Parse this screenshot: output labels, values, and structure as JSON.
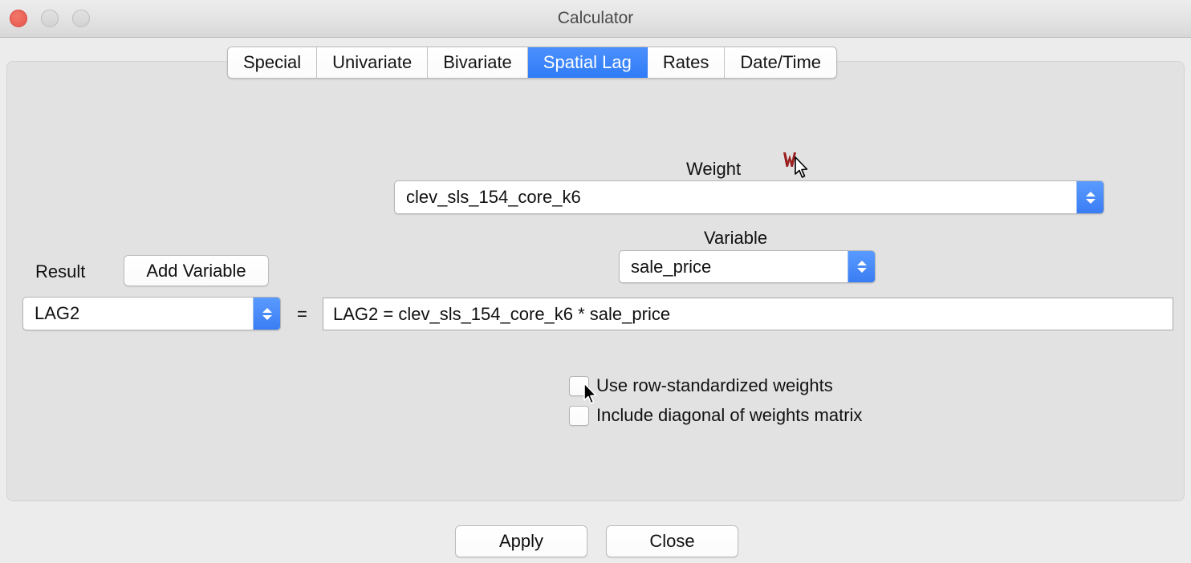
{
  "window": {
    "title": "Calculator",
    "traffic_lights": [
      {
        "name": "close",
        "color": "#e8564a"
      },
      {
        "name": "minimize",
        "color": "#d8d8d8"
      },
      {
        "name": "maximize",
        "color": "#d8d8d8"
      }
    ]
  },
  "tabs": [
    {
      "label": "Special",
      "active": false
    },
    {
      "label": "Univariate",
      "active": false
    },
    {
      "label": "Bivariate",
      "active": false
    },
    {
      "label": "Spatial Lag",
      "active": true
    },
    {
      "label": "Rates",
      "active": false
    },
    {
      "label": "Date/Time",
      "active": false
    }
  ],
  "form": {
    "weight_label": "Weight",
    "weight_icon": "weights-w-icon",
    "weight_value": "clev_sls_154_core_k6",
    "variable_label": "Variable",
    "variable_value": "sale_price",
    "result_label": "Result",
    "add_variable_label": "Add Variable",
    "result_value": "LAG2",
    "equals": "=",
    "expression": "LAG2 = clev_sls_154_core_k6 * sale_price"
  },
  "options": [
    {
      "label": "Use row-standardized weights",
      "checked": false
    },
    {
      "label": "Include diagonal of weights matrix",
      "checked": false
    }
  ],
  "footer": {
    "apply_label": "Apply",
    "close_label": "Close"
  },
  "colors": {
    "accent_blue": "#3a7df3",
    "close_red": "#e8564a",
    "weight_icon_red": "#9d2020",
    "window_bg": "#ececec",
    "panel_bg": "#e2e2e2"
  }
}
